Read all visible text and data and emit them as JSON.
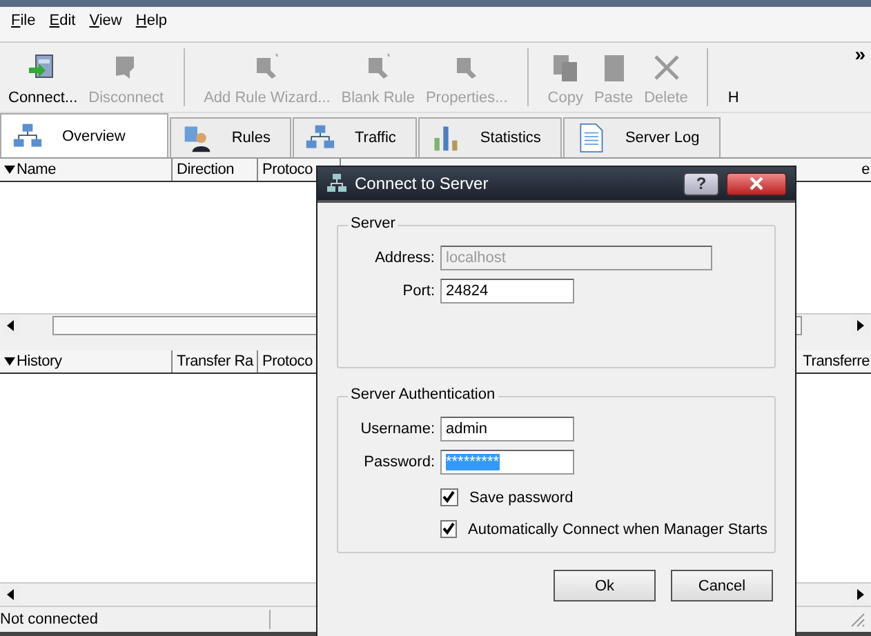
{
  "menu": [
    "File",
    "Edit",
    "View",
    "Help"
  ],
  "toolbar": {
    "groups": [
      [
        {
          "label": "Connect...",
          "disabled": false,
          "kind": "connect"
        },
        {
          "label": "Disconnect",
          "disabled": true,
          "kind": "disconnect"
        }
      ],
      [
        {
          "label": "Add Rule Wizard...",
          "disabled": true,
          "kind": "wizard"
        },
        {
          "label": "Blank Rule",
          "disabled": true,
          "kind": "wizard"
        },
        {
          "label": "Properties...",
          "disabled": true,
          "kind": "properties"
        }
      ],
      [
        {
          "label": "Copy",
          "disabled": true,
          "kind": "copy"
        },
        {
          "label": "Paste",
          "disabled": true,
          "kind": "paste"
        },
        {
          "label": "Delete",
          "disabled": true,
          "kind": "delete"
        }
      ],
      [
        {
          "label": "H",
          "disabled": false,
          "kind": "none"
        }
      ]
    ],
    "overflow": "»"
  },
  "tabs": [
    {
      "label": "Overview",
      "selected": true,
      "kind": "network"
    },
    {
      "label": "Rules",
      "selected": false,
      "kind": "user"
    },
    {
      "label": "Traffic",
      "selected": false,
      "kind": "network"
    },
    {
      "label": "Statistics",
      "selected": false,
      "kind": "chart"
    },
    {
      "label": "Server Log",
      "selected": false,
      "kind": "document"
    }
  ],
  "top_table": {
    "columns": [
      "Name",
      "Direction",
      "Protoco",
      "e"
    ]
  },
  "bottom_table": {
    "columns": [
      "History",
      "Transfer Ra",
      "Protoco",
      "Transferre"
    ]
  },
  "status_bar": {
    "text": "Not connected"
  },
  "dialog": {
    "title": "Connect to Server",
    "help_button": "?",
    "server": {
      "title": "Server",
      "fields": [
        {
          "label": "Address:",
          "value": "localhost",
          "disabled": true
        },
        {
          "label": "Port:",
          "value": "24824",
          "disabled": false
        }
      ]
    },
    "auth": {
      "title": "Server Authentication",
      "fields": [
        {
          "label": "Username:",
          "value": "admin",
          "selected": false
        },
        {
          "label": "Password:",
          "value": "*********",
          "selected": true
        }
      ],
      "checkboxes": [
        {
          "label": "Save password",
          "checked": true
        },
        {
          "label": "Automatically Connect when Manager Starts",
          "checked": true
        }
      ]
    },
    "buttons": [
      "Ok",
      "Cancel"
    ]
  }
}
